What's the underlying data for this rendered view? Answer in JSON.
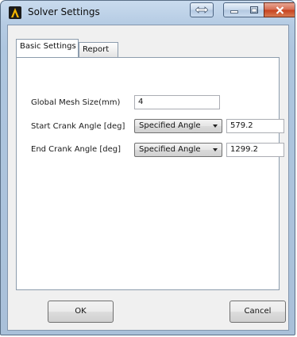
{
  "window": {
    "title": "Solver Settings",
    "app_icon": "solver-logo-icon"
  },
  "tabs": [
    {
      "label": "Basic Settings",
      "active": true
    },
    {
      "label": "Report",
      "active": false
    }
  ],
  "form": {
    "mesh_size": {
      "label": "Global Mesh Size(mm)",
      "value": "4"
    },
    "start_angle": {
      "label": "Start Crank Angle [deg]",
      "mode": "Specified Angle",
      "value": "579.2"
    },
    "end_angle": {
      "label": "End Crank Angle [deg]",
      "mode": "Specified Angle",
      "value": "1299.2"
    }
  },
  "buttons": {
    "ok": "OK",
    "cancel": "Cancel"
  },
  "colors": {
    "title_bar": "#b5cbe3",
    "close_button": "#c6401d",
    "dialog_bg": "#f0f0f0"
  }
}
